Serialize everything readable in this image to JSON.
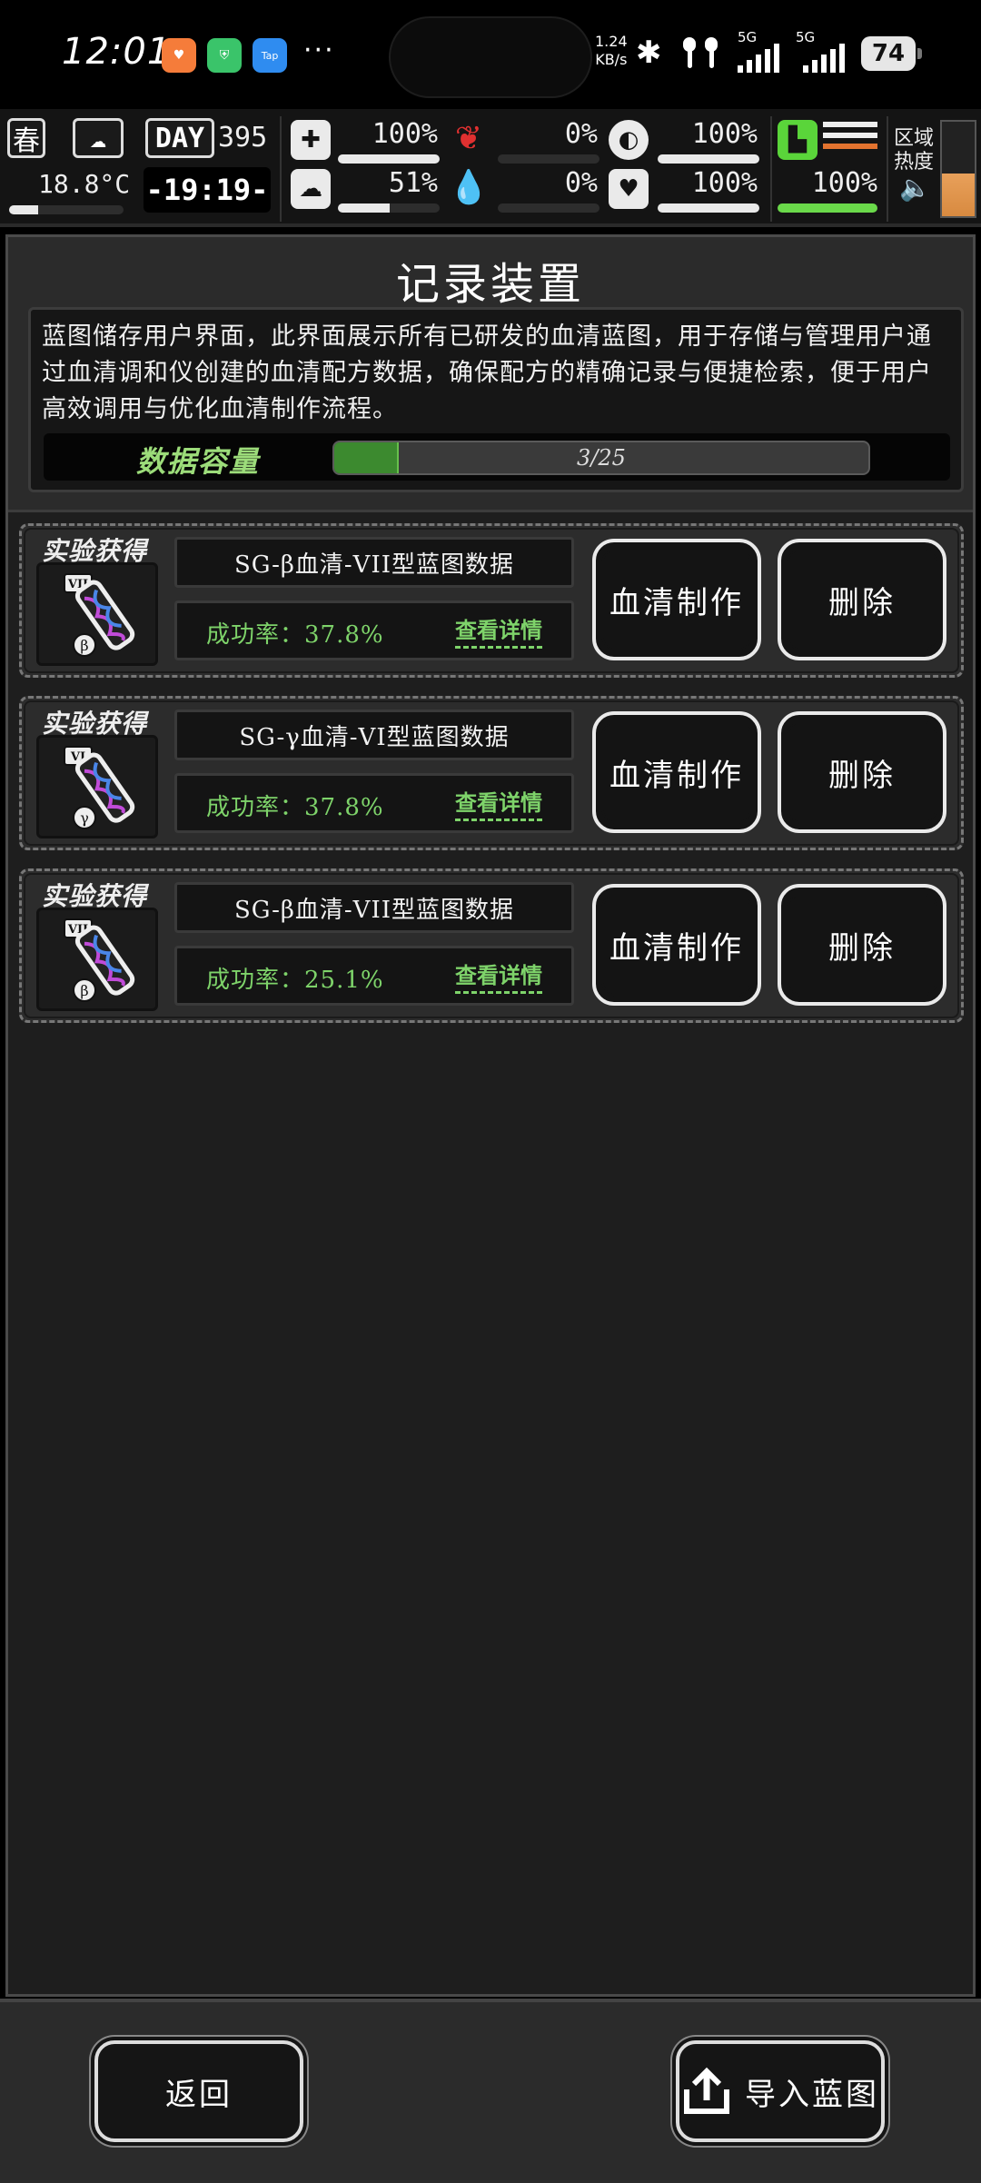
{
  "status_bar": {
    "time": "12:01",
    "more": "···",
    "speed_value": "1.24",
    "speed_unit": "KB/s",
    "network_1": "5G",
    "network_2": "5G",
    "battery": "74",
    "app_icons": [
      "heart-app-icon",
      "shield-app-icon",
      "tap-app-icon"
    ],
    "tap_label": "Tap"
  },
  "hud": {
    "season": "春",
    "temperature": "18.8°C",
    "day_label": "DAY",
    "day_value": "395",
    "clock": "-19:19-",
    "stats": [
      {
        "icon": "medkit-icon",
        "value": "100%",
        "level": 1.0
      },
      {
        "icon": "stomach-icon",
        "value": "0%",
        "level": 0.0
      },
      {
        "icon": "pill-icon",
        "value": "100%",
        "level": 1.0
      },
      {
        "icon": "brain-icon",
        "value": "51%",
        "level": 0.51
      },
      {
        "icon": "blood-drop-icon",
        "value": "0%",
        "level": 0.0
      },
      {
        "icon": "heart-icon",
        "value": "100%",
        "level": 1.0
      }
    ],
    "stamina": {
      "value": "100%",
      "level": 1.0
    },
    "region_heat_label_1": "区域",
    "region_heat_label_2": "热度",
    "heat_level": 0.45
  },
  "panel": {
    "title": "记录装置",
    "description": "蓝图储存用户界面，此界面展示所有已研发的血清蓝图，用于存储与管理用户通过血清调和仪创建的血清配方数据，确保配方的精确记录与便捷检索，便于用户高效调用与优化血清制作流程。",
    "capacity_label": "数据容量",
    "capacity_text": "3/25",
    "capacity_used": 3,
    "capacity_total": 25
  },
  "cards": [
    {
      "source": "实验获得",
      "badge": "VII",
      "greek": "β",
      "name": "SG-β血清-VII型蓝图数据",
      "rate": "成功率：37.8%",
      "detail": "查看详情",
      "make": "血清制作",
      "delete": "删除"
    },
    {
      "source": "实验获得",
      "badge": "VI",
      "greek": "γ",
      "name": "SG-γ血清-VI型蓝图数据",
      "rate": "成功率：37.8%",
      "detail": "查看详情",
      "make": "血清制作",
      "delete": "删除"
    },
    {
      "source": "实验获得",
      "badge": "VII",
      "greek": "β",
      "name": "SG-β血清-VII型蓝图数据",
      "rate": "成功率：25.1%",
      "detail": "查看详情",
      "make": "血清制作",
      "delete": "删除"
    }
  ],
  "footer": {
    "back": "返回",
    "import": "导入蓝图"
  },
  "colors": {
    "accent_green": "#7ed36a",
    "capacity_fill": "#3c8a2f",
    "danger_red": "#e03030",
    "panel_bg": "#2b2b2b"
  }
}
